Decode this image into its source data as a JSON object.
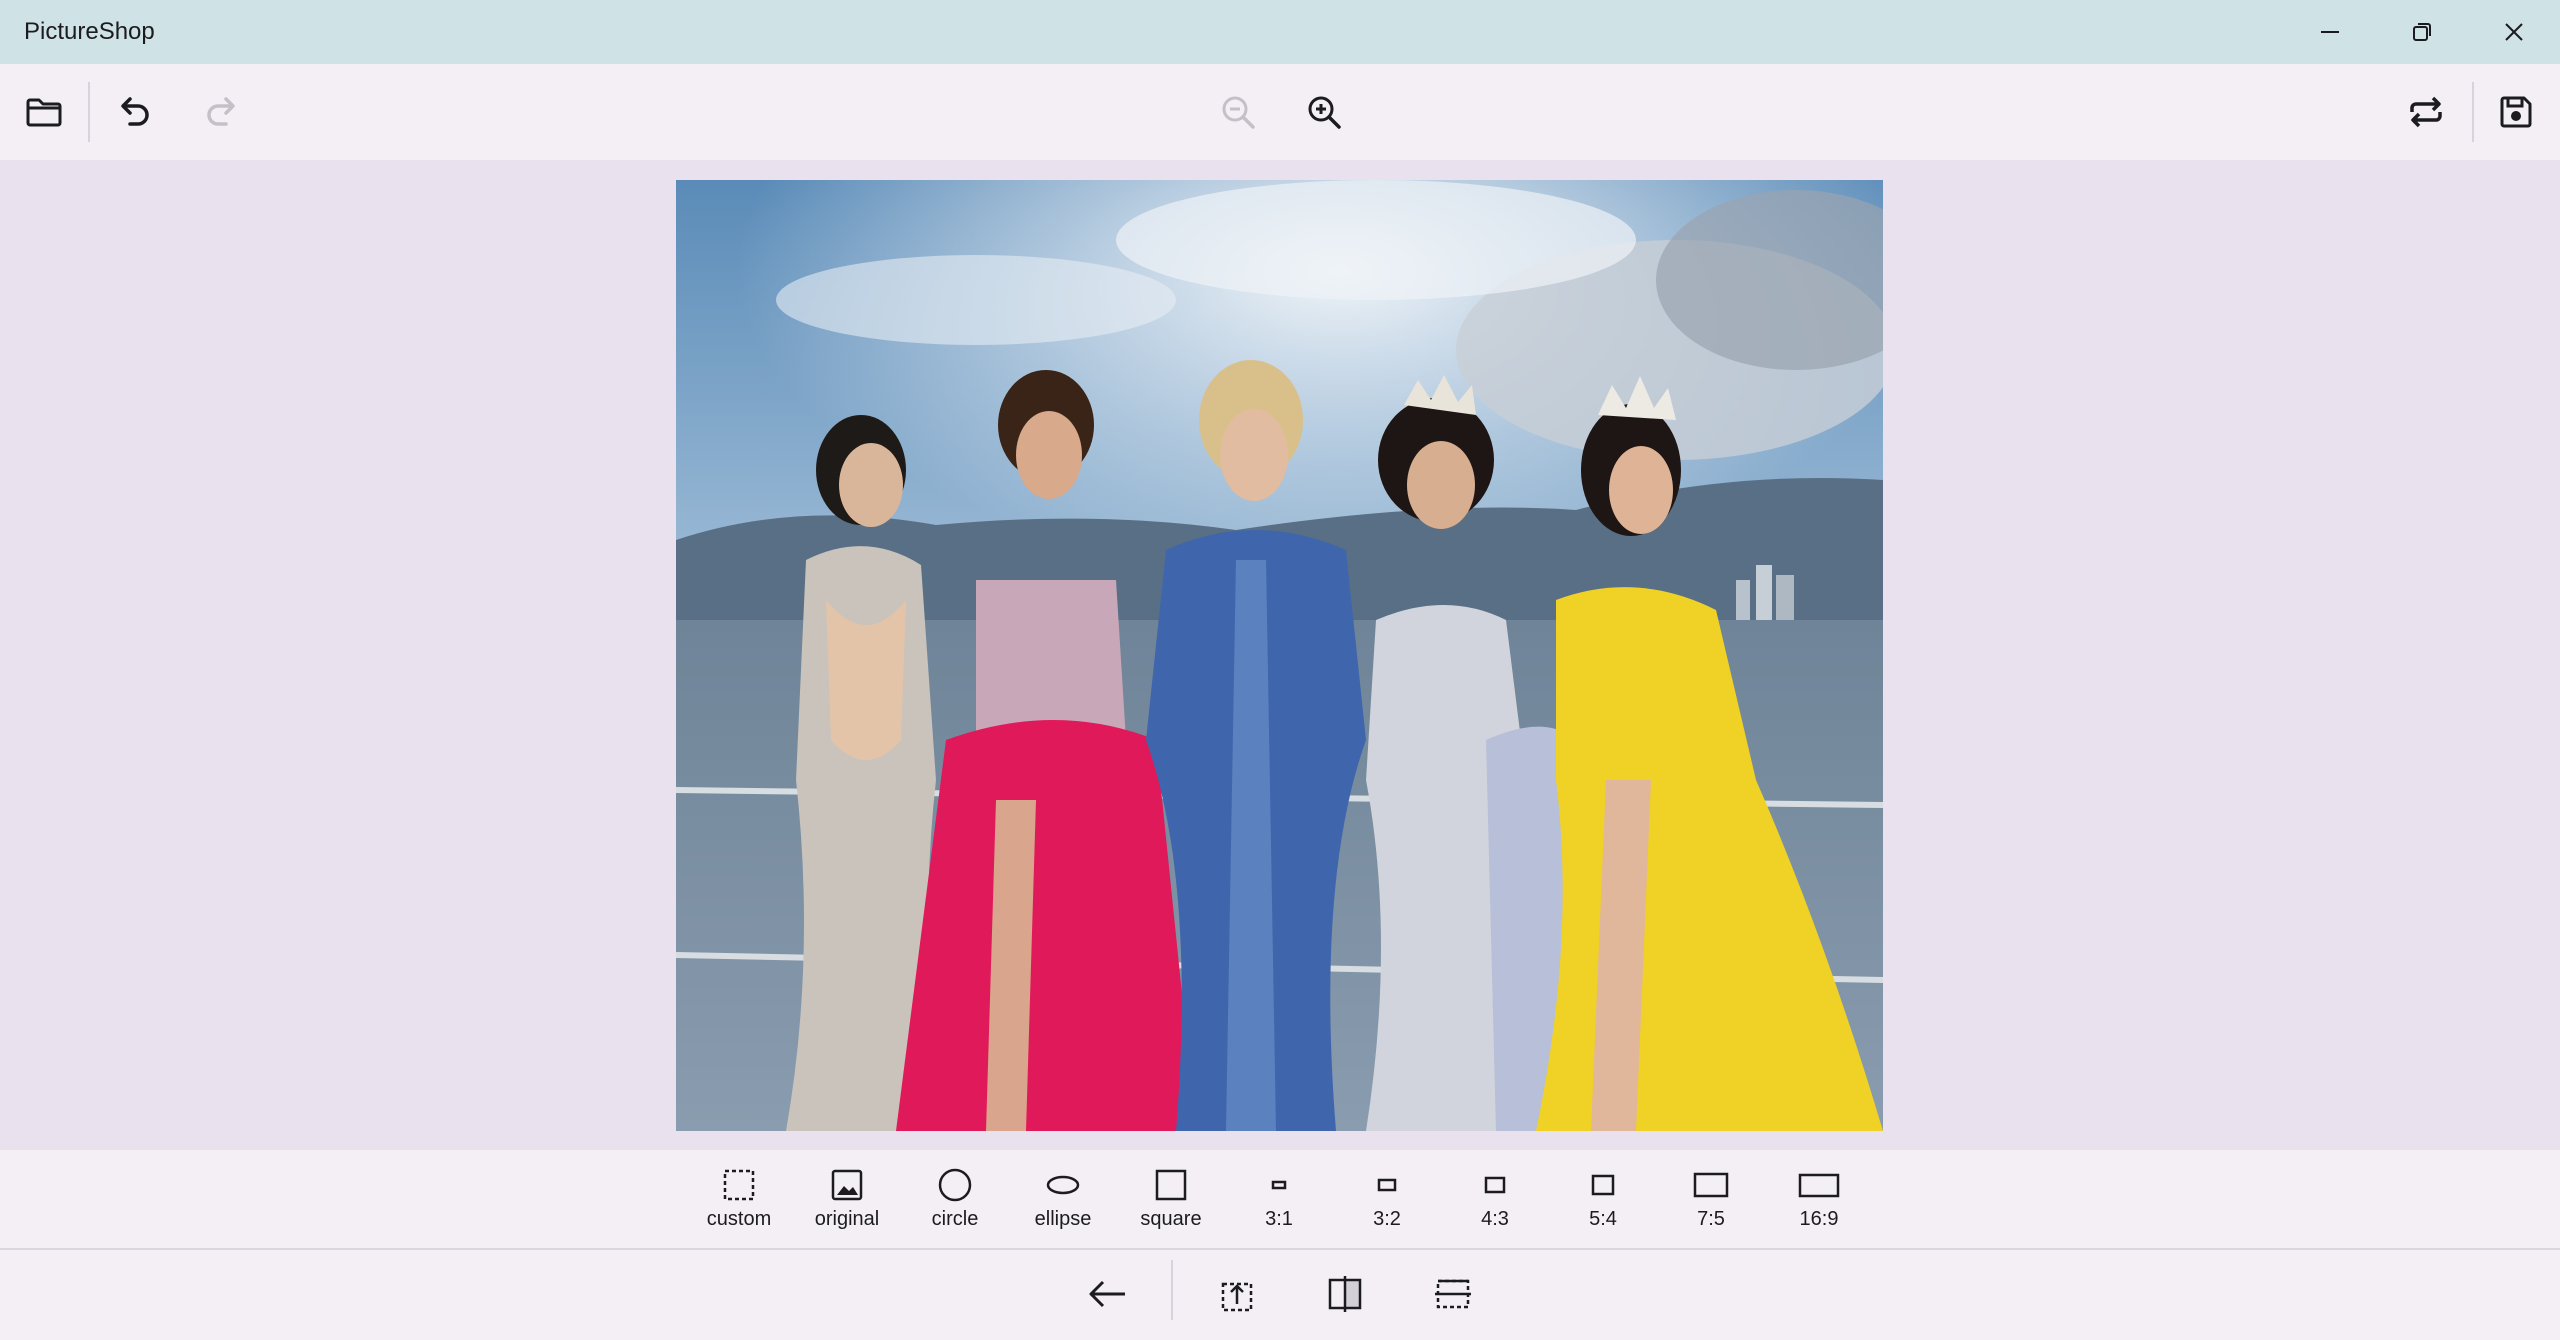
{
  "window": {
    "title": "PictureShop"
  },
  "toolbar": {
    "buttons": [
      {
        "icon": "folder-icon",
        "label": "open"
      },
      {
        "icon": "undo-icon",
        "label": "undo"
      },
      {
        "icon": "redo-icon",
        "label": "redo",
        "disabled": true
      },
      {
        "icon": "zoom-out-icon",
        "label": "zoom out",
        "disabled": true
      },
      {
        "icon": "zoom-in-icon",
        "label": "zoom in"
      },
      {
        "icon": "sync-icon",
        "label": "refresh"
      },
      {
        "icon": "save-icon",
        "label": "save"
      }
    ]
  },
  "crop": {
    "options": [
      {
        "id": "custom",
        "label": "custom",
        "icon": "dashed-square-icon"
      },
      {
        "id": "original",
        "label": "original",
        "icon": "image-icon"
      },
      {
        "id": "circle",
        "label": "circle",
        "icon": "circle-icon"
      },
      {
        "id": "ellipse",
        "label": "ellipse",
        "icon": "ellipse-icon"
      },
      {
        "id": "square",
        "label": "square",
        "icon": "square-icon"
      },
      {
        "id": "r3-1",
        "label": "3:1",
        "icon": "rect-3-1-icon"
      },
      {
        "id": "r3-2",
        "label": "3:2",
        "icon": "rect-3-2-icon"
      },
      {
        "id": "r4-3",
        "label": "4:3",
        "icon": "rect-4-3-icon"
      },
      {
        "id": "r5-4",
        "label": "5:4",
        "icon": "rect-5-4-icon"
      },
      {
        "id": "r7-5",
        "label": "7:5",
        "icon": "rect-7-5-icon"
      },
      {
        "id": "r16-9",
        "label": "16:9",
        "icon": "rect-16-9-icon"
      }
    ]
  },
  "bottom": {
    "buttons": [
      {
        "icon": "arrow-left-icon"
      },
      {
        "icon": "rotate-icon"
      },
      {
        "icon": "flip-horizontal-icon"
      },
      {
        "icon": "flip-vertical-icon"
      }
    ]
  },
  "colors": {
    "titlebar": "#cfe2e6",
    "toolbar": "#f3eff5",
    "canvas": "#e9e2ee"
  }
}
